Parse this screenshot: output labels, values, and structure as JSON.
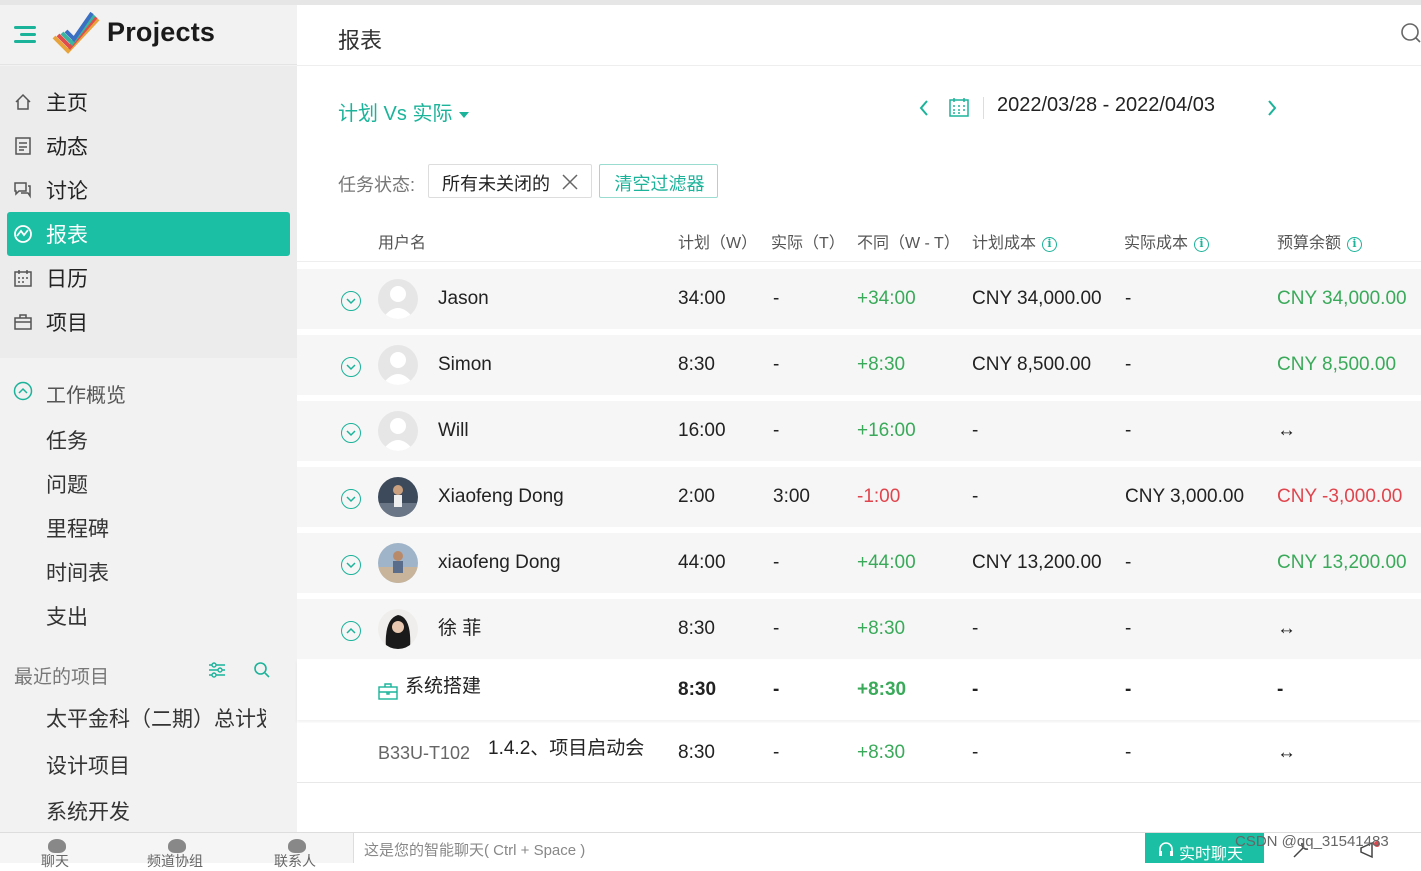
{
  "app": {
    "brand": "Projects"
  },
  "sidebar": {
    "nav": [
      {
        "label": "主页",
        "icon": "home-icon"
      },
      {
        "label": "动态",
        "icon": "feed-icon"
      },
      {
        "label": "讨论",
        "icon": "discussion-icon"
      },
      {
        "label": "报表",
        "icon": "report-icon",
        "active": true
      },
      {
        "label": "日历",
        "icon": "calendar-icon"
      },
      {
        "label": "项目",
        "icon": "briefcase-icon"
      }
    ],
    "work_overview": {
      "label": "工作概览",
      "items": [
        "任务",
        "问题",
        "里程碑",
        "时间表",
        "支出"
      ]
    },
    "recent": {
      "label": "最近的项目",
      "items": [
        "太平金科（二期）总计划",
        "设计项目",
        "系统开发"
      ]
    }
  },
  "header": {
    "title": "报表"
  },
  "report": {
    "view_label": "计划 Vs 实际",
    "date_range": "2022/03/28 - 2022/04/03",
    "filter_label": "任务状态:",
    "filter_chip": "所有未关闭的",
    "clear_filter": "清空过滤器"
  },
  "table": {
    "headers": {
      "user": "用户名",
      "plan": "计划（W）",
      "actual": "实际（T）",
      "diff": "不同（W - T）",
      "plan_cost": "计划成本",
      "actual_cost": "实际成本",
      "budget": "预算余额"
    },
    "rows": [
      {
        "name": "Jason",
        "plan": "34:00",
        "actual": "-",
        "diff": "+34:00",
        "plan_cost": "CNY 34,000.00",
        "actual_cost": "-",
        "budget": "CNY 34,000.00"
      },
      {
        "name": "Simon",
        "plan": "8:30",
        "actual": "-",
        "diff": "+8:30",
        "plan_cost": "CNY 8,500.00",
        "actual_cost": "-",
        "budget": "CNY 8,500.00"
      },
      {
        "name": "Will",
        "plan": "16:00",
        "actual": "-",
        "diff": "+16:00",
        "plan_cost": "-",
        "actual_cost": "-",
        "budget": "↔"
      },
      {
        "name": "Xiaofeng Dong",
        "plan": "2:00",
        "actual": "3:00",
        "diff": "-1:00",
        "plan_cost": "-",
        "actual_cost": "CNY 3,000.00",
        "budget": "CNY -3,000.00"
      },
      {
        "name": "xiaofeng Dong",
        "plan": "44:00",
        "actual": "-",
        "diff": "+44:00",
        "plan_cost": "CNY 13,200.00",
        "actual_cost": "-",
        "budget": "CNY 13,200.00"
      },
      {
        "name": "徐 菲",
        "plan": "8:30",
        "actual": "-",
        "diff": "+8:30",
        "plan_cost": "-",
        "actual_cost": "-",
        "budget": "↔"
      }
    ],
    "project_row": {
      "name": "系统搭建",
      "plan": "8:30",
      "actual": "-",
      "diff": "+8:30",
      "plan_cost": "-",
      "actual_cost": "-",
      "budget": "-"
    },
    "task_row": {
      "id": "B33U-T102",
      "name": "1.4.2、项目启动会",
      "plan": "8:30",
      "actual": "-",
      "diff": "+8:30",
      "plan_cost": "-",
      "actual_cost": "-",
      "budget": "↔"
    }
  },
  "bottom": {
    "tabs": [
      "聊天",
      "频道协组",
      "联系人"
    ],
    "chat_placeholder": "这是您的智能聊天( Ctrl + Space )",
    "live_chat": "实时聊天"
  },
  "watermark": "CSDN @qq_31541483",
  "colors": {
    "accent": "#1bbfa3",
    "positive": "#3aaa5a",
    "negative": "#e0454d"
  }
}
